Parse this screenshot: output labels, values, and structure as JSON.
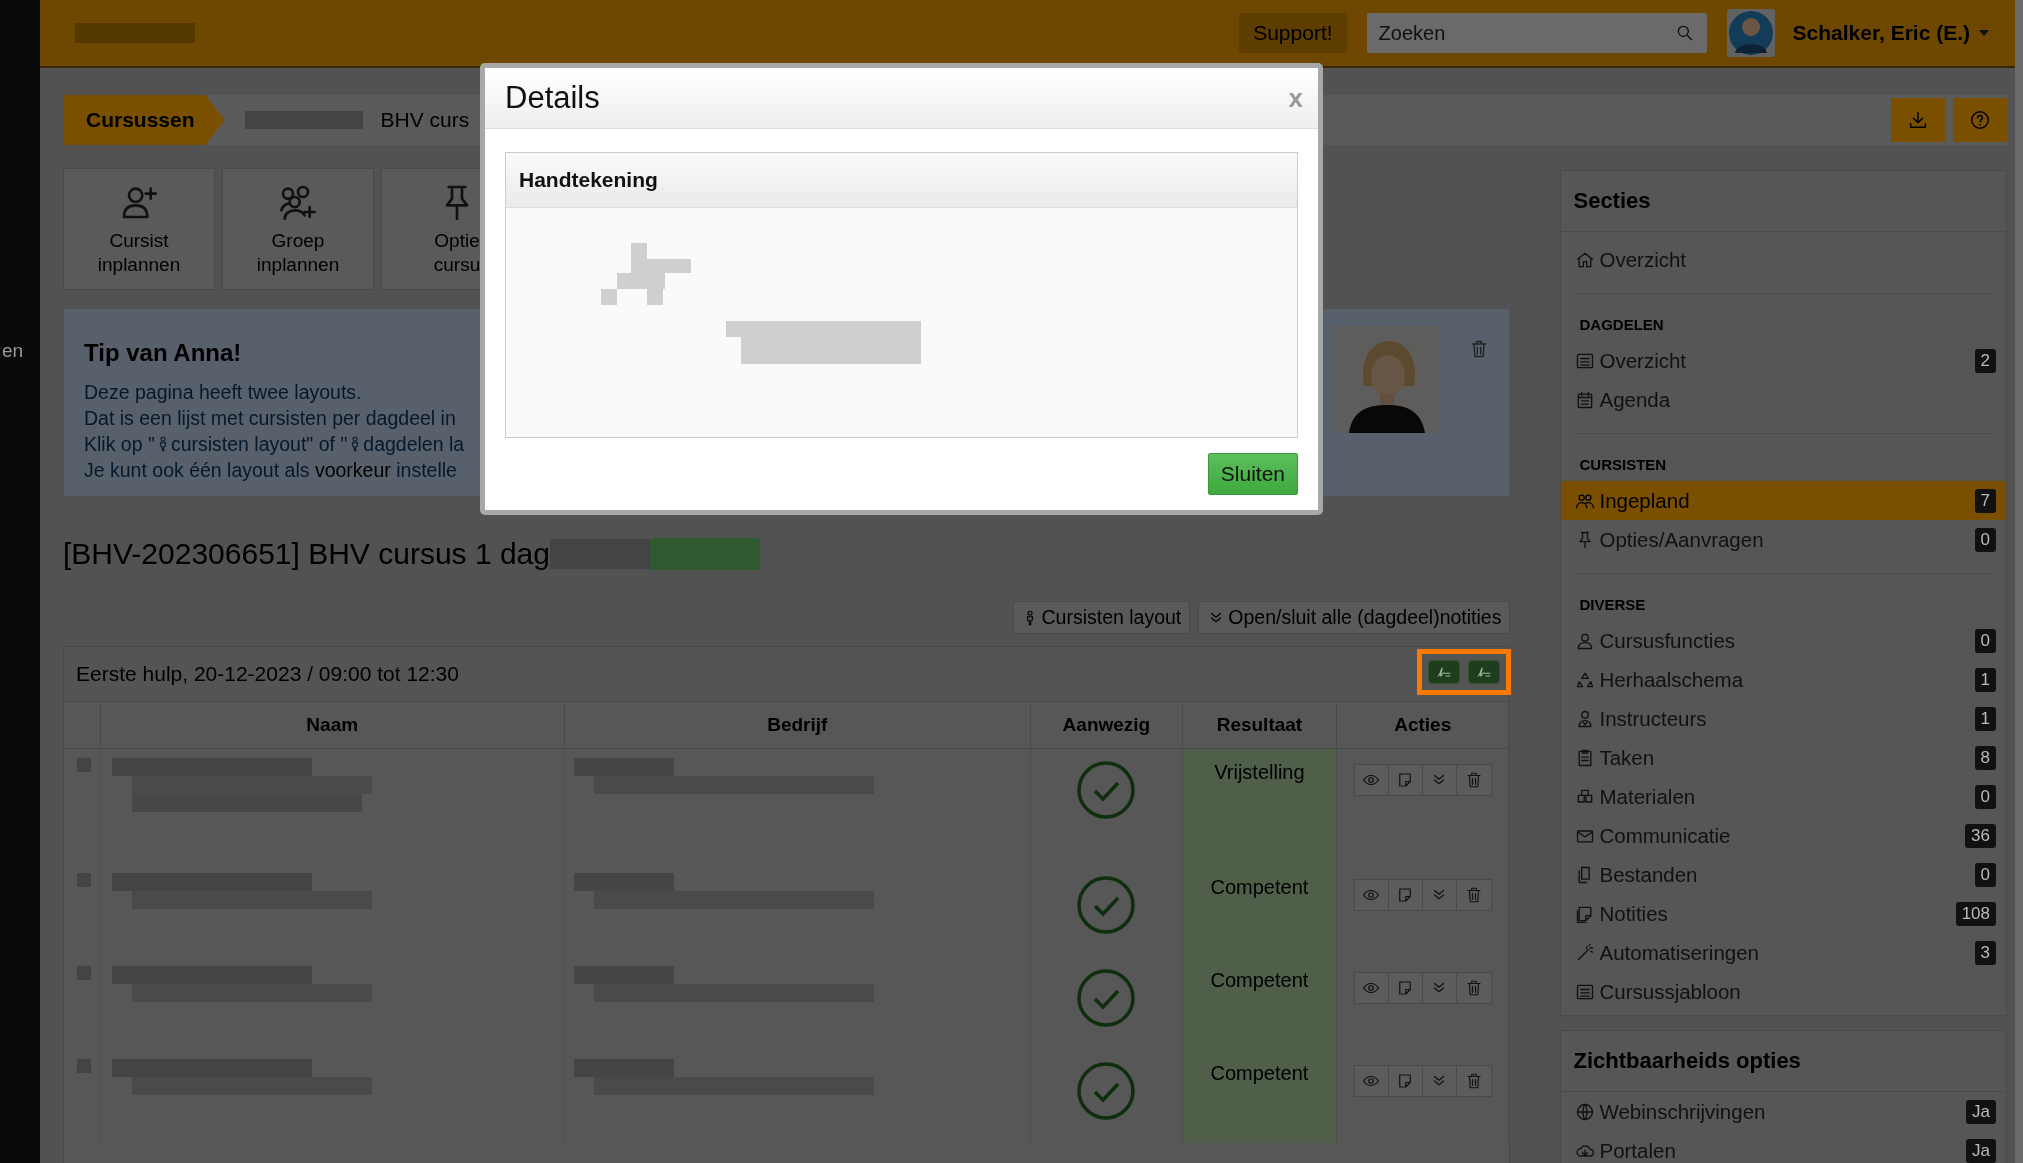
{
  "left_strip": {
    "text": "en"
  },
  "topbar": {
    "support": "Support!",
    "search": {
      "placeholder": "Zoeken"
    },
    "user": "Schalker, Eric (E.)"
  },
  "breadcrumb": [
    {
      "label": "Cursussen",
      "selected": true
    },
    {
      "label": "BHV curs",
      "selected": false
    }
  ],
  "tiles": [
    {
      "lines": [
        "Cursist",
        "inplannen"
      ]
    },
    {
      "lines": [
        "Groep",
        "inplannen"
      ]
    },
    {
      "lines": [
        "Optie",
        "cursu"
      ]
    }
  ],
  "tip": {
    "title": "Tip van Anna!",
    "line1": "Deze pagina heeft twee layouts.",
    "line2": "Dat is een lijst met cursisten per dagdeel in",
    "line3": [
      "Klik op \"",
      "cursisten layout\" of \"",
      "dagdelen la"
    ],
    "line4": "Je kunt ook één layout als ",
    "link": "voorkeur",
    "line4_end": " instelle"
  },
  "heading": "[BHV-202306651] BHV cursus 1 dag",
  "toolbar": [
    "Cursisten layout",
    "Open/sluit alle (dagdeel)notities"
  ],
  "session": {
    "title": "Eerste hulp, 20-12-2023 / 09:00 tot 12:30",
    "columns": [
      "Naam",
      "Bedrijf",
      "Aanwezig",
      "Resultaat",
      "Acties"
    ],
    "rows": [
      {
        "present": true,
        "result": "Vrijstelling"
      },
      {
        "present": true,
        "result": "Competent"
      },
      {
        "present": true,
        "result": "Competent"
      },
      {
        "present": true,
        "result": "Competent"
      }
    ]
  },
  "sidebar": {
    "title": "Secties",
    "groups": [
      {
        "items": [
          {
            "label": "Overzicht",
            "selected": false
          }
        ]
      },
      {
        "heading": "DAGDELEN",
        "items": [
          {
            "label": "Overzicht",
            "count": "2",
            "selected": false
          },
          {
            "label": "Agenda",
            "selected": false
          }
        ]
      },
      {
        "heading": "CURSISTEN",
        "items": [
          {
            "label": "Ingepland",
            "count": "7",
            "selected": true
          },
          {
            "label": "Opties/Aanvragen",
            "count": "0",
            "selected": false
          }
        ]
      },
      {
        "heading": "DIVERSE",
        "items": [
          {
            "label": "Cursusfuncties",
            "count": "0",
            "selected": false
          },
          {
            "label": "Herhaalschema",
            "count": "1",
            "selected": false
          },
          {
            "label": "Instructeurs",
            "count": "1",
            "selected": false
          },
          {
            "label": "Taken",
            "count": "8",
            "selected": false
          },
          {
            "label": "Materialen",
            "count": "0",
            "selected": false
          },
          {
            "label": "Communicatie",
            "count": "36",
            "selected": false
          },
          {
            "label": "Bestanden",
            "count": "0",
            "selected": false
          },
          {
            "label": "Notities",
            "count": "108",
            "selected": false
          },
          {
            "label": "Automatiseringen",
            "count": "3",
            "selected": false
          },
          {
            "label": "Cursussjabloon",
            "selected": false
          }
        ]
      }
    ]
  },
  "visibility": {
    "title": "Zichtbaarheids opties",
    "items": [
      {
        "label": "Webinschrijvingen",
        "value": "Ja"
      },
      {
        "label": "Portalen",
        "value": "Ja"
      }
    ]
  },
  "modal": {
    "title": "Details",
    "close": "x",
    "panel_title": "Handtekening",
    "button": "Sluiten"
  }
}
